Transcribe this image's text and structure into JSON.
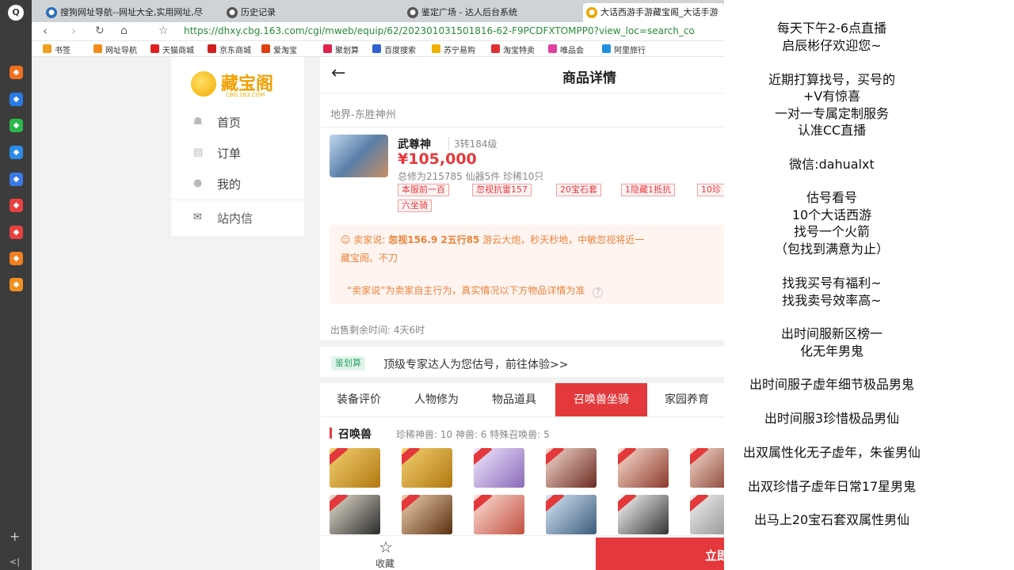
{
  "browser": {
    "tabs": [
      {
        "label": "搜狗网址导航--网址大全,实用网址,尽",
        "icon": "sogou-icon",
        "color": "#2a6fb8"
      },
      {
        "label": "历史记录",
        "icon": "history-icon",
        "color": "#555555"
      },
      {
        "label": "鉴定广场 - 达人后台系统",
        "icon": "globe-icon",
        "color": "#555555"
      },
      {
        "label": "大话西游手游藏宝阁_大话手游",
        "icon": "cbg-icon",
        "color": "#e8a800"
      }
    ],
    "url": "https://dhxy.cbg.163.com/cgi/mweb/equip/62/202301031501816-62-F9PCDFXTOMPP0?view_loc=search_co",
    "bookmarks": [
      {
        "label": "书签",
        "icon": "star-icon",
        "color": "#f0a020"
      },
      {
        "label": "网址导航",
        "icon": "nav-icon",
        "color": "#f08c1c"
      },
      {
        "label": "天猫商城",
        "icon": "tmall-icon",
        "color": "#e02020"
      },
      {
        "label": "京东商城",
        "icon": "jd-icon",
        "color": "#d02020"
      },
      {
        "label": "爱淘宝",
        "icon": "aitaobao-icon",
        "color": "#e04010"
      },
      {
        "label": "聚划算",
        "icon": "juhuasuan-icon",
        "color": "#e02050"
      },
      {
        "label": "百度搜索",
        "icon": "baidu-icon",
        "color": "#3060d0"
      },
      {
        "label": "苏宁易购",
        "icon": "suning-icon",
        "color": "#f0b000"
      },
      {
        "label": "淘宝特卖",
        "icon": "taobao-icon",
        "color": "#e03030"
      },
      {
        "label": "唯品会",
        "icon": "vip-icon",
        "color": "#e040a0"
      },
      {
        "label": "阿里旅行",
        "icon": "alitrip-icon",
        "color": "#2090e0"
      }
    ]
  },
  "dock": {
    "icons": [
      "logo-icon",
      "history-icon",
      "message-icon",
      "wechat-icon",
      "share-icon",
      "cloud-icon",
      "download-icon",
      "pdf-icon",
      "search-icon",
      "folder-icon"
    ],
    "colors": [
      "#ffffff",
      "#f07020",
      "#2a7ae8",
      "#2ab84a",
      "#2a8ae8",
      "#3a7ae8",
      "#e84040",
      "#e84040",
      "#f08020",
      "#f09020"
    ]
  },
  "sidebar": {
    "brand": "藏宝阁",
    "brand_sub": "CBG.163.COM",
    "items": [
      {
        "label": "首页",
        "icon": "home-icon"
      },
      {
        "label": "订单",
        "icon": "order-icon"
      },
      {
        "label": "我的",
        "icon": "user-icon"
      },
      {
        "label": "站内信",
        "icon": "mail-icon"
      }
    ]
  },
  "product": {
    "header_title": "商品详情",
    "server": "地界-东胜神州",
    "name": "武尊神",
    "level": "3转184级",
    "price": "¥105,000",
    "stats": "总修为215785  仙器5件  珍稀10只",
    "tags": [
      "本服前一百",
      "忽视抗雷157",
      "20宝石套",
      "1隐藏1抵抗",
      "10珍",
      "六坐骑"
    ],
    "seller_label": "卖家说:",
    "seller_bold": "忽视156.9 2五行85",
    "seller_text": "游云大炮，秒天秒地，中敏忽视将近一",
    "seller_line2": "藏宝阁。不刀",
    "disclaimer": "“卖家说”为卖家自主行为，真实情况以下方物品详情为准",
    "remaining": "出售剩余时间: 4天6时",
    "jianding_tag": "鉴划算",
    "jianding_text": "顶级专家达人为您估号，前往体验>>",
    "tabs": [
      "装备评价",
      "人物修为",
      "物品道具",
      "召唤兽坐骑",
      "家园养育"
    ],
    "active_tab": 3,
    "pets_title": "召唤兽",
    "pets_stats": "珍稀神兽: 10   神兽: 6   特殊召唤兽: 5",
    "pets": [
      {
        "colors": [
          "#f4d070",
          "#b07810"
        ],
        "badge": true
      },
      {
        "colors": [
          "#f4d070",
          "#b07810"
        ],
        "badge": true
      },
      {
        "colors": [
          "#f0e8ff",
          "#8a6ab8"
        ],
        "badge": true
      },
      {
        "colors": [
          "#f8dcd0",
          "#6a2a20"
        ],
        "badge": true
      },
      {
        "colors": [
          "#fbe0d4",
          "#8a3a2a"
        ],
        "badge": true
      },
      {
        "colors": [
          "#f8dcd0",
          "#7a3020"
        ],
        "badge": true
      },
      {
        "colors": [
          "#e8e0d0",
          "#2a2a2a"
        ],
        "badge": true
      },
      {
        "colors": [
          "#f0d0b0",
          "#5a3010"
        ],
        "badge": true
      },
      {
        "colors": [
          "#ffe0d8",
          "#c05040"
        ],
        "badge": true
      },
      {
        "colors": [
          "#d8e8f8",
          "#3a5a7a"
        ],
        "badge": true
      },
      {
        "colors": [
          "#ffffff",
          "#333333"
        ],
        "badge": true
      },
      {
        "colors": [
          "#f0f0f0",
          "#888888"
        ],
        "badge": true
      }
    ],
    "favorite": "收藏",
    "buy": "立即"
  },
  "overlay": {
    "lines": [
      "每天下午2-6点直播",
      "启辰彬仔欢迎您~",
      "近期打算找号，买号的",
      "+V有惊喜",
      "一对一专属定制服务",
      "认准CC直播",
      "微信:dahualxt",
      "估号看号",
      "10个大话西游",
      "找号一个火箭",
      "（包找到满意为止）",
      "找我买号有福利~",
      "找我卖号效率高~",
      "出时间服新区榜一",
      "化无年男鬼",
      "出时间服子虚年细节极品男鬼",
      "出时间服3珍惜极品男仙",
      "出双属性化无子虚年，朱雀男仙",
      "出双珍惜子虚年日常17星男鬼",
      "出马上20宝石套双属性男仙"
    ]
  }
}
